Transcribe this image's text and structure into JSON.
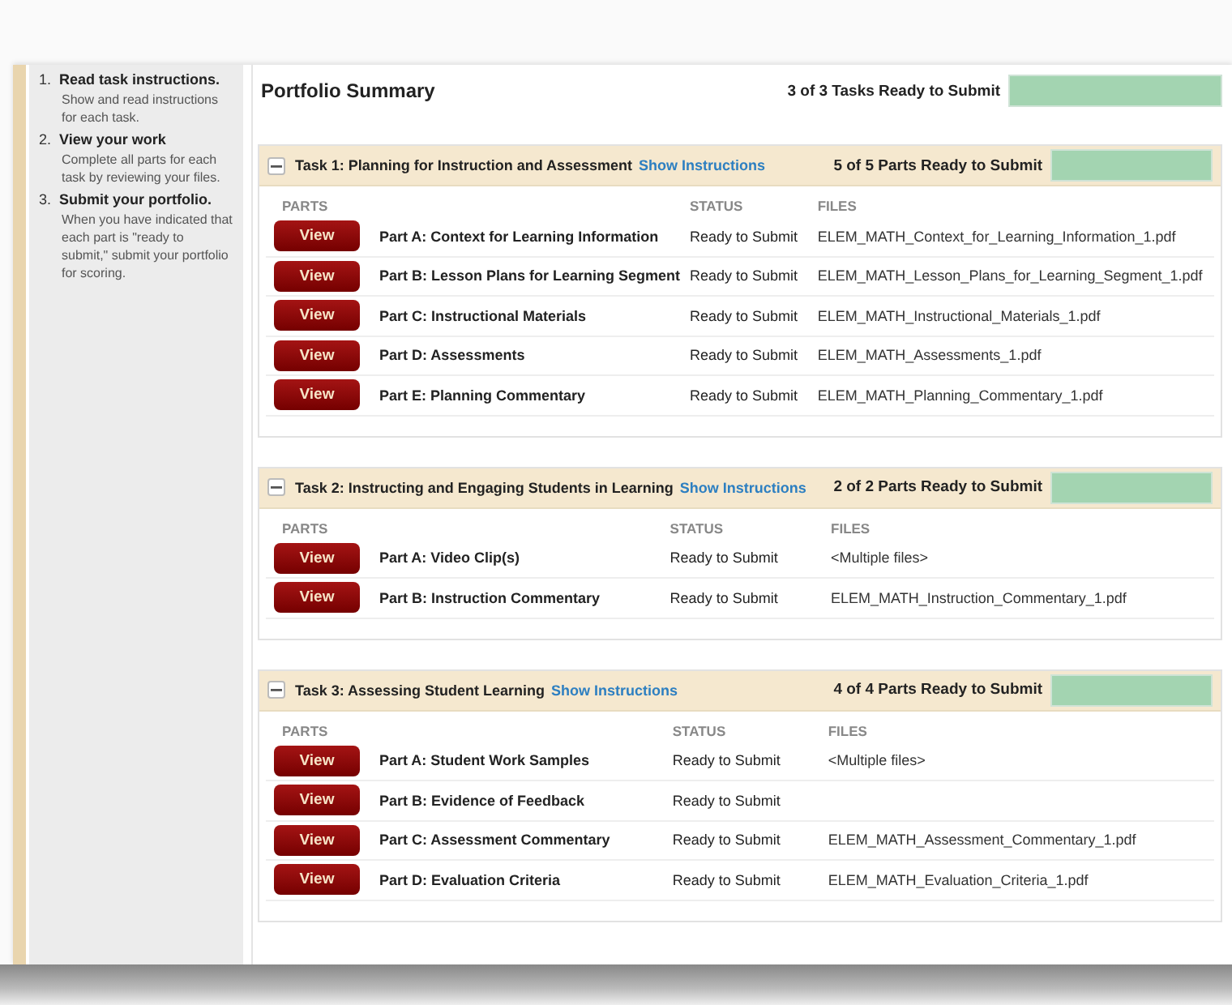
{
  "sidebar": {
    "steps": [
      {
        "number": "1.",
        "title": "Read task instructions.",
        "text": "Show and read instructions for each task."
      },
      {
        "number": "2.",
        "title": "View your work",
        "text": "Complete all parts for each task by reviewing your files."
      },
      {
        "number": "3.",
        "title": "Submit your portfolio.",
        "text": "When you have indicated that each part is \"ready to submit,\" submit your portfolio for scoring."
      }
    ]
  },
  "summary": {
    "title": "Portfolio Summary",
    "progress_text": "3 of 3 Tasks Ready to Submit",
    "level": 1
  },
  "tasks": [
    {
      "title": "Task 1: Planning for Instruction and Assessment",
      "link": "Show Instructions",
      "progress_text": "5 of 5 Parts Ready to Submit",
      "level": 1,
      "expanded": true,
      "columns": [
        "PARTS",
        "STATUS",
        "FILES"
      ],
      "parts": [
        {
          "button": "View",
          "name": "Part A: Context for Learning Information",
          "status": "Ready to Submit",
          "file": "ELEM_MATH_Context_for_Learning_Information_1.pdf"
        },
        {
          "button": "View",
          "name": "Part B: Lesson Plans for Learning Segment",
          "status": "Ready to Submit",
          "file": "ELEM_MATH_Lesson_Plans_for_Learning_Segment_1.pdf"
        },
        {
          "button": "View",
          "name": "Part C: Instructional Materials",
          "status": "Ready to Submit",
          "file": "ELEM_MATH_Instructional_Materials_1.pdf"
        },
        {
          "button": "View",
          "name": "Part D: Assessments",
          "status": "Ready to Submit",
          "file": "ELEM_MATH_Assessments_1.pdf"
        },
        {
          "button": "View",
          "name": "Part E: Planning Commentary",
          "status": "Ready to Submit",
          "file": "ELEM_MATH_Planning_Commentary_1.pdf"
        }
      ]
    },
    {
      "title": "Task 2: Instructing and Engaging Students in Learning",
      "link": "Show Instructions",
      "progress_text": "2 of 2 Parts Ready to Submit",
      "level": 1,
      "expanded": true,
      "columns": [
        "PARTS",
        "STATUS",
        "FILES"
      ],
      "parts": [
        {
          "button": "View",
          "name": "Part A: Video Clip(s)",
          "status": "Ready to Submit",
          "file": "<Multiple files>"
        },
        {
          "button": "View",
          "name": "Part B: Instruction Commentary",
          "status": "Ready to Submit",
          "file": "ELEM_MATH_Instruction_Commentary_1.pdf"
        }
      ]
    },
    {
      "title": "Task 3: Assessing Student Learning",
      "link": "Show Instructions",
      "progress_text": "4 of 4 Parts Ready to Submit",
      "level": 1,
      "expanded": true,
      "columns": [
        "PARTS",
        "STATUS",
        "FILES"
      ],
      "parts": [
        {
          "button": "View",
          "name": "Part A: Student Work Samples",
          "status": "Ready to Submit",
          "file": "<Multiple files>"
        },
        {
          "button": "View",
          "name": "Part B: Evidence of Feedback",
          "status": "Ready to Submit"
        },
        {
          "button": "View",
          "name": "Part C: Assessment Commentary",
          "status": "Ready to Submit",
          "file": "ELEM_MATH_Assessment_Commentary_1.pdf"
        },
        {
          "button": "View",
          "name": "Part D: Evaluation Criteria",
          "status": "Ready to Submit",
          "file": "ELEM_MATH_Evaluation_Criteria_1.pdf"
        }
      ]
    }
  ]
}
